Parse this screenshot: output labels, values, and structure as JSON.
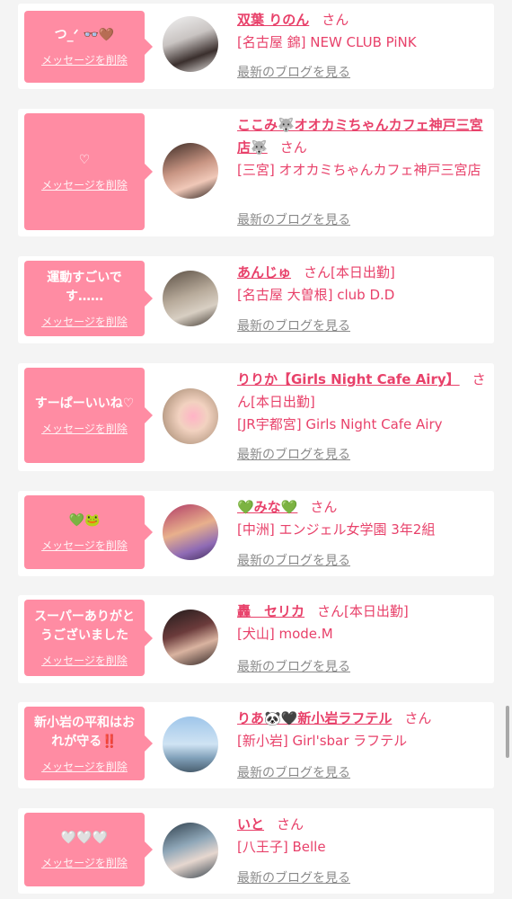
{
  "colors": {
    "page_background": "#f4f4f4",
    "card_background": "#ffffff",
    "bubble_pink": "#ff8ca3",
    "name_pink": "#e8416a",
    "link_gray": "#8a8a8a"
  },
  "labels": {
    "delete_message": "メッセージを削除",
    "view_latest_blog": "最新のブログを見る",
    "honorific": "さん"
  },
  "messages": [
    {
      "bubble_text": "つ_ᐟ 👓🤎",
      "name": "双葉 りのん",
      "status": "",
      "shop": "[名古屋 錦] NEW CLUB PiNK",
      "avatar": "avatar-photo"
    },
    {
      "bubble_text": "♡",
      "name": "ここみ🐺オオカミちゃんカフェ神戸三宮店🐺",
      "status": "",
      "shop": "[三宮] オオカミちゃんカフェ神戸三宮店",
      "avatar": "avatar-photo"
    },
    {
      "bubble_text": "運動すごいです……",
      "name": "あんじゅ",
      "status": "[本日出勤]",
      "shop": "[名古屋 大曽根] club D.D",
      "avatar": "avatar-photo"
    },
    {
      "bubble_text": "すーぱーいいね♡",
      "name": "りりか【Girls Night Cafe Airy】",
      "status": "[本日出勤]",
      "shop": "[JR宇都宮] Girls Night Cafe Airy",
      "avatar": "avatar-photo"
    },
    {
      "bubble_text": "💚🐸",
      "name": "💚みな💚",
      "status": "",
      "shop": "[中洲] エンジェル女学園 3年2組",
      "avatar": "avatar-photo"
    },
    {
      "bubble_text": "スーパーありがとうございました",
      "name": "轟　セリカ",
      "status": "[本日出勤]",
      "shop": "[犬山] mode.M",
      "avatar": "avatar-photo"
    },
    {
      "bubble_text": "新小岩の平和はおれが守る‼️",
      "name": "りあ🐼🖤新小岩ラフテル",
      "status": "",
      "shop": "[新小岩] Girl'sbar ラフテル",
      "avatar": "avatar-photo"
    },
    {
      "bubble_text": "🤍🤍🤍",
      "name": "いと",
      "status": "",
      "shop": "[八王子] Belle",
      "avatar": "avatar-photo"
    }
  ]
}
